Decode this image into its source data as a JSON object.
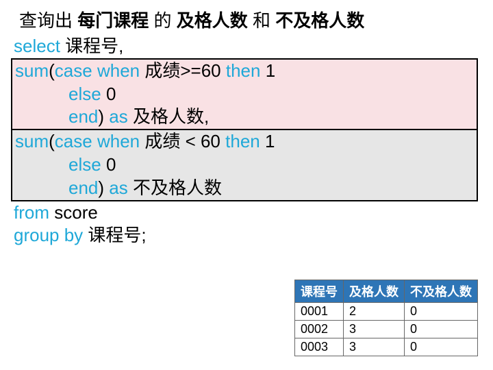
{
  "title": {
    "t1": "查询出",
    "b1": "每门课程",
    "t2": "的",
    "b2": "及格人数",
    "t3": "和",
    "b3": "不及格人数"
  },
  "sql": {
    "select": "select",
    "col1": "课程号,",
    "sum": "sum",
    "case": "case",
    "when": "when",
    "cond1": "成绩>=60",
    "cond2": "成绩 <  60",
    "then": "then",
    "one": "1",
    "else": "else",
    "zero": "0",
    "end": "end",
    "as": "as",
    "alias1": "及格人数,",
    "alias2": "不及格人数",
    "from": "from",
    "table": "score",
    "groupby": "group by",
    "groupcol": "课程号;"
  },
  "result": {
    "headers": [
      "课程号",
      "及格人数",
      "不及格人数"
    ],
    "rows": [
      [
        "0001",
        "2",
        "0"
      ],
      [
        "0002",
        "3",
        "0"
      ],
      [
        "0003",
        "3",
        "0"
      ]
    ]
  }
}
